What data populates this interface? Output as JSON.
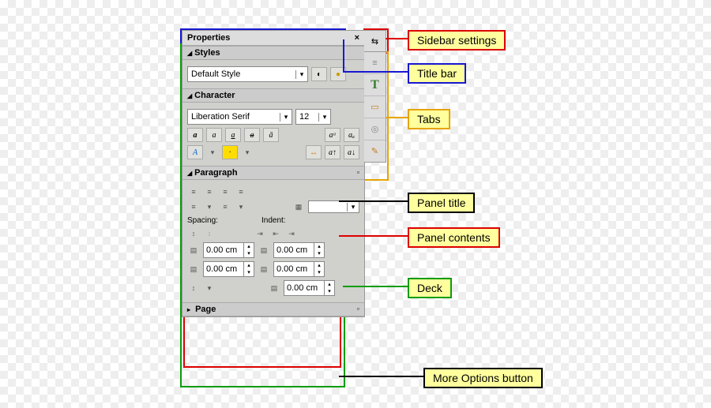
{
  "titlebar": {
    "title": "Properties",
    "close": "×"
  },
  "styles": {
    "head": "Styles",
    "selected": "Default Style"
  },
  "character": {
    "head": "Character",
    "font": "Liberation Serif",
    "size": "12",
    "row1": [
      "a",
      "a",
      "a",
      "a",
      "a",
      "a",
      "a"
    ],
    "row2": [
      "A",
      "·",
      "·",
      "·",
      "&",
      "a",
      "a"
    ]
  },
  "paragraph": {
    "head": "Paragraph",
    "spacing_label": "Spacing:",
    "indent_label": "Indent:",
    "val": "0.00 cm"
  },
  "page": {
    "head": "Page"
  },
  "settings_icon": "⇆",
  "tabs": [
    "≡",
    "T",
    "▭",
    "◎",
    "✎"
  ],
  "labels": {
    "settings": "Sidebar settings",
    "titlebar": "Title bar",
    "tabs": "Tabs",
    "panel_title": "Panel title",
    "panel_contents": "Panel contents",
    "deck": "Deck",
    "more": "More Options button"
  }
}
